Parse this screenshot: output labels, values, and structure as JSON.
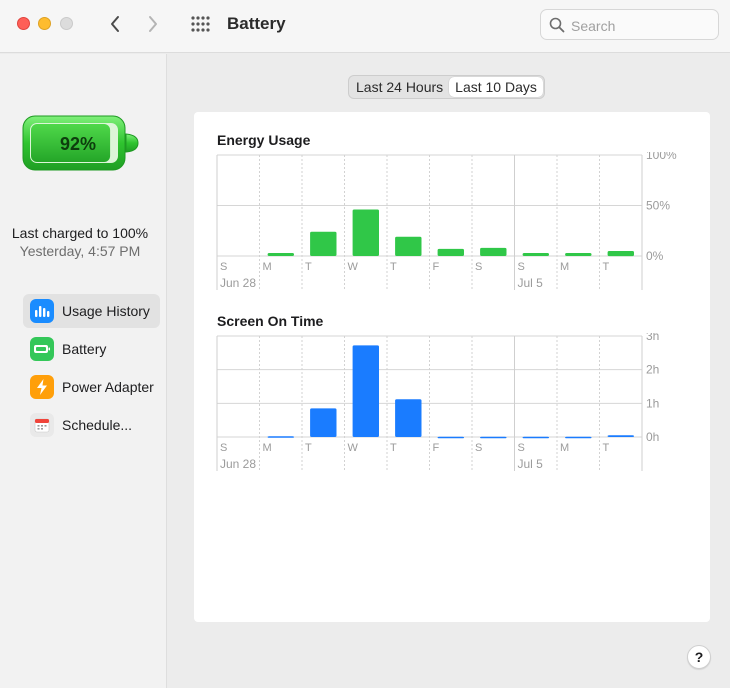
{
  "window": {
    "title": "Battery",
    "search_placeholder": "Search"
  },
  "sidebar": {
    "battery_level": "92%",
    "battery_level_fraction": 0.92,
    "last_charged": "Last charged to 100%",
    "last_charged_time": "Yesterday, 4:57 PM",
    "items": [
      {
        "label": "Usage History",
        "icon": "usage-history-icon",
        "color": "#1a8cff",
        "selected": true
      },
      {
        "label": "Battery",
        "icon": "battery-item-icon",
        "color": "#34c759",
        "selected": false
      },
      {
        "label": "Power Adapter",
        "icon": "power-adapter-icon",
        "color": "#ff9f0a",
        "selected": false
      },
      {
        "label": "Schedule...",
        "icon": "schedule-icon",
        "color": "#e9e9e9",
        "selected": false
      }
    ]
  },
  "segment": {
    "options": [
      "Last 24 Hours",
      "Last 10 Days"
    ],
    "selected": "Last 10 Days"
  },
  "colors": {
    "energy": "#30c748",
    "screen": "#1a7cff"
  },
  "chart_data": [
    {
      "type": "bar",
      "title": "Energy Usage",
      "categories": [
        "S",
        "M",
        "T",
        "W",
        "T",
        "F",
        "S",
        "S",
        "M",
        "T"
      ],
      "group_labels": [
        {
          "label": "Jun 28",
          "index": 0
        },
        {
          "label": "Jul 5",
          "index": 7
        }
      ],
      "y_ticks": [
        "100%",
        "50%",
        "0%"
      ],
      "ylim": [
        0,
        100
      ],
      "values": [
        0,
        3,
        24,
        46,
        19,
        7,
        8,
        3,
        3,
        5
      ],
      "grid": true
    },
    {
      "type": "bar",
      "title": "Screen On Time",
      "categories": [
        "S",
        "M",
        "T",
        "W",
        "T",
        "F",
        "S",
        "S",
        "M",
        "T"
      ],
      "group_labels": [
        {
          "label": "Jun 28",
          "index": 0
        },
        {
          "label": "Jul 5",
          "index": 7
        }
      ],
      "y_ticks": [
        "3h",
        "2h",
        "1h",
        "0h"
      ],
      "ylim": [
        0,
        3
      ],
      "values": [
        0,
        0.02,
        0.85,
        2.72,
        1.12,
        0.01,
        0.01,
        0.01,
        0.01,
        0.05
      ],
      "grid": true
    }
  ]
}
